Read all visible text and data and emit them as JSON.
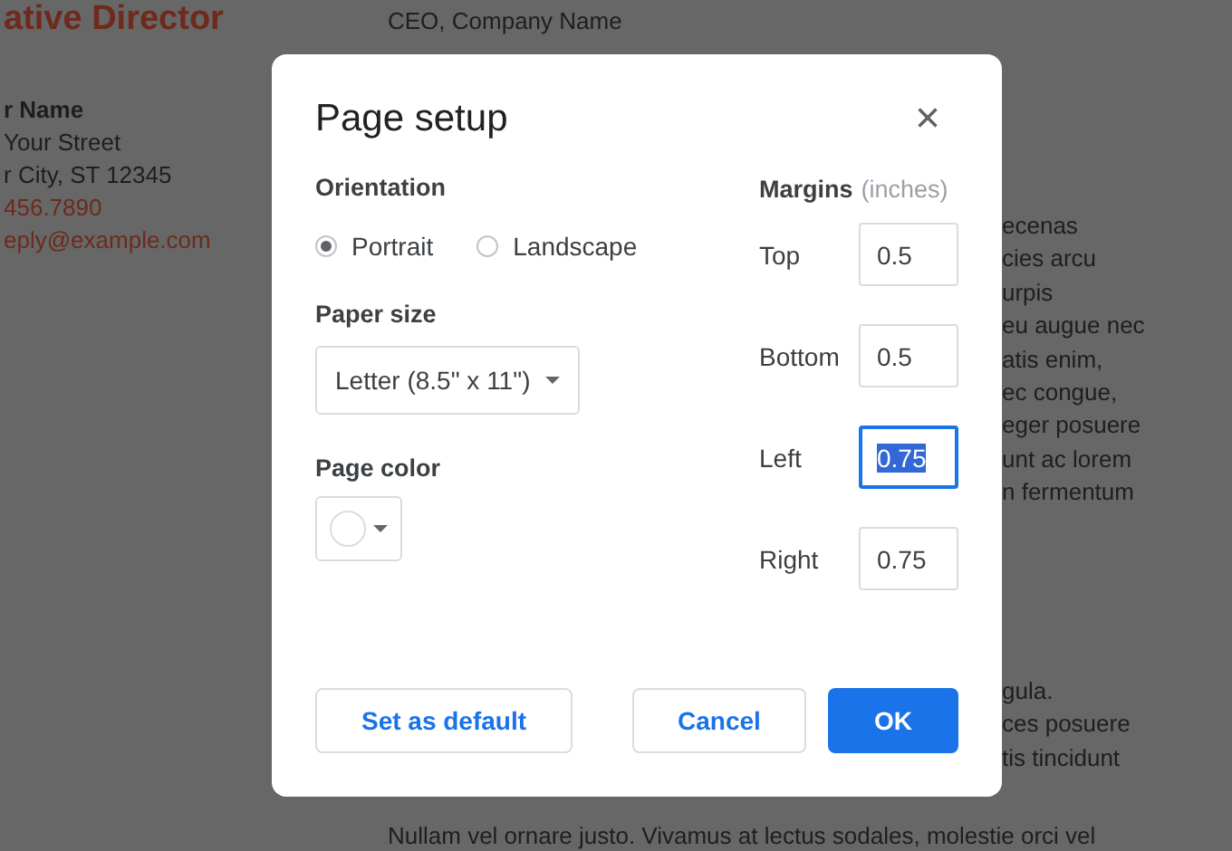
{
  "document": {
    "left_column": [
      {
        "text": "ative Director",
        "kind": "heading"
      },
      {
        "text": "r Name",
        "kind": "bold"
      },
      {
        "text": "Your Street",
        "kind": "plain"
      },
      {
        "text": "r City, ST 12345",
        "kind": "plain"
      },
      {
        "text": "456.7890",
        "kind": "accent"
      },
      {
        "text": "eply@example.com",
        "kind": "accent"
      }
    ],
    "recipient": [
      "CEO, Company Name"
    ],
    "right_fragments": [
      "ecenas",
      "cies arcu",
      "urpis",
      "eu augue nec",
      "atis enim,",
      "ec congue,",
      "eger posuere",
      "unt ac lorem",
      "n fermentum"
    ],
    "lower_fragments": [
      "gula.",
      "ces posuere",
      "tis tincidunt"
    ],
    "last_paragraph": "Nullam vel ornare justo. Vivamus at lectus sodales, molestie orci vel"
  },
  "dialog": {
    "title": "Page setup",
    "close": "×",
    "orientation": {
      "label": "Orientation",
      "options": [
        {
          "label": "Portrait",
          "selected": true
        },
        {
          "label": "Landscape",
          "selected": false
        }
      ]
    },
    "paper_size": {
      "label": "Paper size",
      "value": "Letter (8.5\" x 11\")"
    },
    "page_color": {
      "label": "Page color",
      "color": "#ffffff"
    },
    "margins": {
      "label": "Margins",
      "unit": "(inches)",
      "fields": [
        {
          "label": "Top",
          "value": "0.5",
          "focused": false
        },
        {
          "label": "Bottom",
          "value": "0.5",
          "focused": false
        },
        {
          "label": "Left",
          "value": "0.75",
          "focused": true
        },
        {
          "label": "Right",
          "value": "0.75",
          "focused": false
        }
      ]
    },
    "buttons": [
      {
        "label": "Set as default",
        "kind": "secondary"
      },
      {
        "label": "Cancel",
        "kind": "secondary"
      },
      {
        "label": "OK",
        "kind": "primary"
      }
    ]
  }
}
